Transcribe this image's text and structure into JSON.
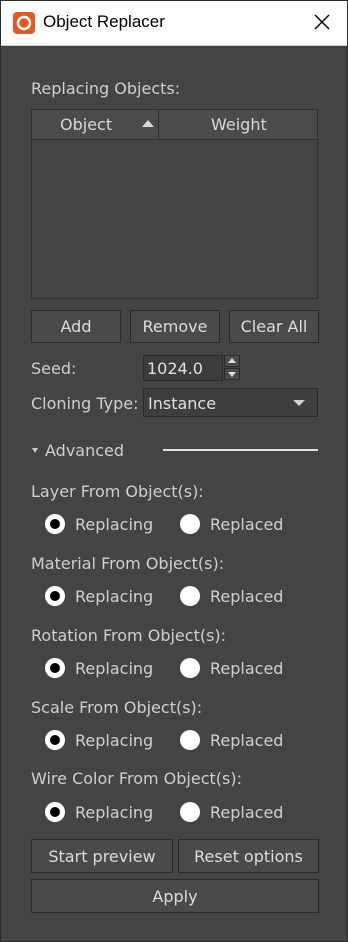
{
  "window": {
    "title": "Object Replacer"
  },
  "replacing_objects": {
    "label": "Replacing Objects:",
    "columns": [
      "Object",
      "Weight"
    ]
  },
  "buttons": {
    "add": "Add",
    "remove": "Remove",
    "clear_all": "Clear All"
  },
  "seed": {
    "label": "Seed:",
    "value": "1024.0"
  },
  "cloning_type": {
    "label": "Cloning Type:",
    "value": "Instance"
  },
  "advanced": {
    "label": "Advanced"
  },
  "options": [
    {
      "label": "Layer From Object(s):",
      "choice_a": "Replacing",
      "choice_b": "Replaced",
      "selected": "Replacing"
    },
    {
      "label": "Material From Object(s):",
      "choice_a": "Replacing",
      "choice_b": "Replaced",
      "selected": "Replacing"
    },
    {
      "label": "Rotation From Object(s):",
      "choice_a": "Replacing",
      "choice_b": "Replaced",
      "selected": "Replacing"
    },
    {
      "label": "Scale From Object(s):",
      "choice_a": "Replacing",
      "choice_b": "Replaced",
      "selected": "Replacing"
    },
    {
      "label": "Wire Color From Object(s):",
      "choice_a": "Replacing",
      "choice_b": "Replaced",
      "selected": "Replacing"
    }
  ],
  "footer": {
    "start_preview": "Start preview",
    "reset_options": "Reset options",
    "apply": "Apply"
  },
  "colors": {
    "panel": "#444444",
    "titlebar": "#ffffff",
    "accent": "#e8561f"
  }
}
